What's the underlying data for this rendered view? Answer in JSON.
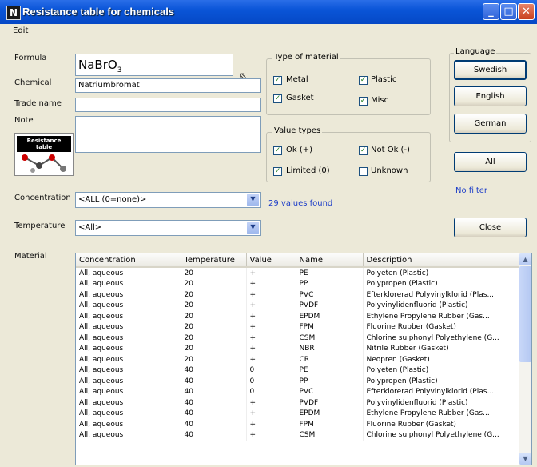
{
  "window": {
    "title": "Resistance table for chemicals",
    "icon": "N"
  },
  "menu": {
    "edit": "Edit"
  },
  "form": {
    "formula_label": "Formula",
    "formula_value": "NaBrO",
    "formula_subscript": "3",
    "chemical_label": "Chemical",
    "chemical_value": "Natriumbromat",
    "tradename_label": "Trade name",
    "tradename_value": "",
    "note_label": "Note",
    "note_value": "",
    "concentration_label": "Concentration",
    "concentration_value": "<ALL (0=none)>",
    "temperature_label": "Temperature",
    "temperature_value": "<All>",
    "values_found": "29 values found",
    "material_label": "Material"
  },
  "type_of_material": {
    "title": "Type of material",
    "items": [
      {
        "label": "Metal",
        "checked": true
      },
      {
        "label": "Plastic",
        "checked": true
      },
      {
        "label": "Gasket",
        "checked": true
      },
      {
        "label": "Misc",
        "checked": true
      }
    ]
  },
  "value_types": {
    "title": "Value types",
    "items": [
      {
        "label": "Ok (+)",
        "checked": true
      },
      {
        "label": "Not Ok (-)",
        "checked": true
      },
      {
        "label": "Limited (0)",
        "checked": true
      },
      {
        "label": "Unknown",
        "checked": false
      }
    ]
  },
  "language": {
    "title": "Language",
    "buttons": [
      "Swedish",
      "English",
      "German"
    ]
  },
  "buttons": {
    "all": "All",
    "close": "Close"
  },
  "filter_status": "No filter",
  "logo_text": "Resistance table",
  "table": {
    "columns": [
      "Concentration",
      "Temperature",
      "Value",
      "Name",
      "Description"
    ],
    "rows": [
      [
        "All, aqueous",
        "20",
        "+",
        "PE",
        "Polyeten (Plastic)"
      ],
      [
        "All, aqueous",
        "20",
        "+",
        "PP",
        "Polypropen (Plastic)"
      ],
      [
        "All, aqueous",
        "20",
        "+",
        "PVC",
        "Efterklorerad Polyvinylklorid (Plas..."
      ],
      [
        "All, aqueous",
        "20",
        "+",
        "PVDF",
        "Polyvinylidenfluorid (Plastic)"
      ],
      [
        "All, aqueous",
        "20",
        "+",
        "EPDM",
        "Ethylene Propylene Rubber (Gas..."
      ],
      [
        "All, aqueous",
        "20",
        "+",
        "FPM",
        "Fluorine Rubber (Gasket)"
      ],
      [
        "All, aqueous",
        "20",
        "+",
        "CSM",
        "Chlorine sulphonyl Polyethylene (G..."
      ],
      [
        "All, aqueous",
        "20",
        "+",
        "NBR",
        "Nitrile Rubber (Gasket)"
      ],
      [
        "All, aqueous",
        "20",
        "+",
        "CR",
        "Neopren (Gasket)"
      ],
      [
        "All, aqueous",
        "40",
        "0",
        "PE",
        "Polyeten (Plastic)"
      ],
      [
        "All, aqueous",
        "40",
        "0",
        "PP",
        "Polypropen (Plastic)"
      ],
      [
        "All, aqueous",
        "40",
        "0",
        "PVC",
        "Efterklorerad Polyvinylklorid (Plas..."
      ],
      [
        "All, aqueous",
        "40",
        "+",
        "PVDF",
        "Polyvinylidenfluorid (Plastic)"
      ],
      [
        "All, aqueous",
        "40",
        "+",
        "EPDM",
        "Ethylene Propylene Rubber (Gas..."
      ],
      [
        "All, aqueous",
        "40",
        "+",
        "FPM",
        "Fluorine Rubber (Gasket)"
      ],
      [
        "All, aqueous",
        "40",
        "+",
        "CSM",
        "Chlorine sulphonyl Polyethylene (G..."
      ]
    ]
  }
}
